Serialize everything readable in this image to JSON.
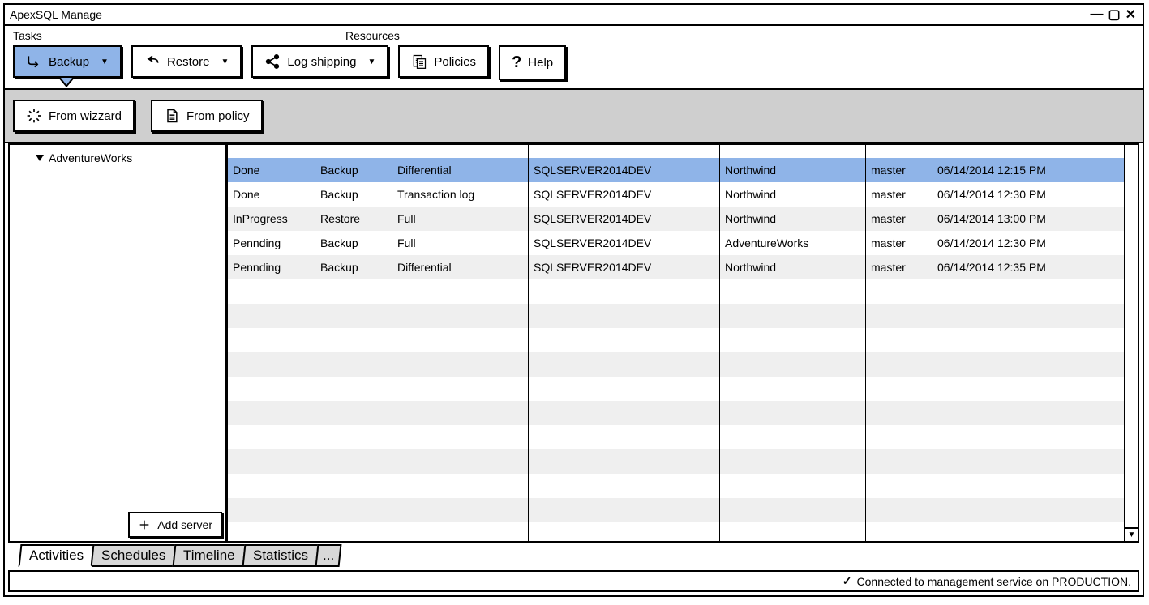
{
  "window": {
    "title": "ApexSQL Manage"
  },
  "ribbon": {
    "sections": {
      "tasks": "Tasks",
      "resources": "Resources"
    },
    "backup": "Backup",
    "restore": "Restore",
    "log_shipping": "Log shipping",
    "policies": "Policies",
    "help": "Help"
  },
  "sub_ribbon": {
    "from_wizzard": "From wizzard",
    "from_policy": "From policy"
  },
  "tree": {
    "items": [
      "AdventureWorks"
    ],
    "add_server": "Add server"
  },
  "table": {
    "rows": [
      {
        "status": "Done",
        "type": "Backup",
        "sub": "Differential",
        "server": "SQLSERVER2014DEV",
        "db": "Northwind",
        "user": "master",
        "time": "06/14/2014 12:15 PM",
        "selected": true
      },
      {
        "status": "Done",
        "type": "Backup",
        "sub": "Transaction log",
        "server": "SQLSERVER2014DEV",
        "db": "Northwind",
        "user": "master",
        "time": "06/14/2014 12:30 PM",
        "selected": false
      },
      {
        "status": "InProgress",
        "type": "Restore",
        "sub": "Full",
        "server": "SQLSERVER2014DEV",
        "db": "Northwind",
        "user": "master",
        "time": "06/14/2014 13:00 PM",
        "selected": false
      },
      {
        "status": "Pennding",
        "type": "Backup",
        "sub": "Full",
        "server": "SQLSERVER2014DEV",
        "db": "AdventureWorks",
        "user": "master",
        "time": "06/14/2014 12:30 PM",
        "selected": false
      },
      {
        "status": "Pennding",
        "type": "Backup",
        "sub": "Differential",
        "server": "SQLSERVER2014DEV",
        "db": "Northwind",
        "user": "master",
        "time": "06/14/2014 12:35 PM",
        "selected": false
      }
    ]
  },
  "tabs": {
    "items": [
      "Activities",
      "Schedules",
      "Timeline",
      "Statistics"
    ],
    "more": "...",
    "active": 0
  },
  "status": {
    "text": "Connected to management service on PRODUCTION."
  }
}
